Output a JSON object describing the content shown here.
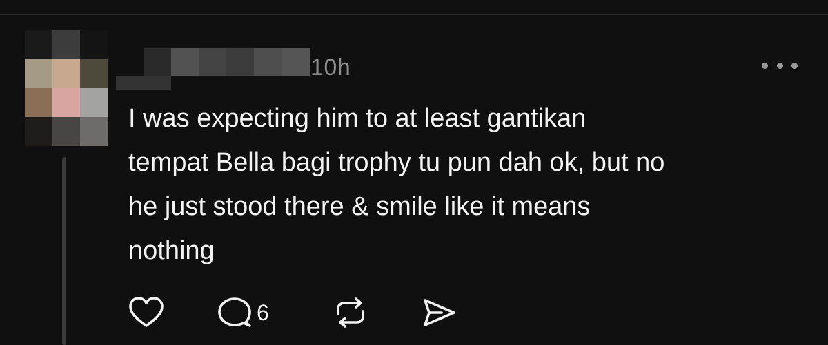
{
  "post": {
    "timestamp": "10h",
    "text": "I was expecting him to at least gantikan\ntempat Bella bagi trophy tu pun dah ok, but no\nhe just stood there & smile like it means\nnothing",
    "actions": {
      "reply_count": "6"
    }
  },
  "icons": {
    "like": "heart-icon",
    "reply": "speech-bubble-icon",
    "repost": "repost-arrows-icon",
    "share": "send-icon",
    "more": "more-dots-icon"
  },
  "colors": {
    "background": "#101010",
    "text": "#f4f4f4",
    "muted": "#8d8d8d",
    "divider": "#2a2a2a"
  }
}
